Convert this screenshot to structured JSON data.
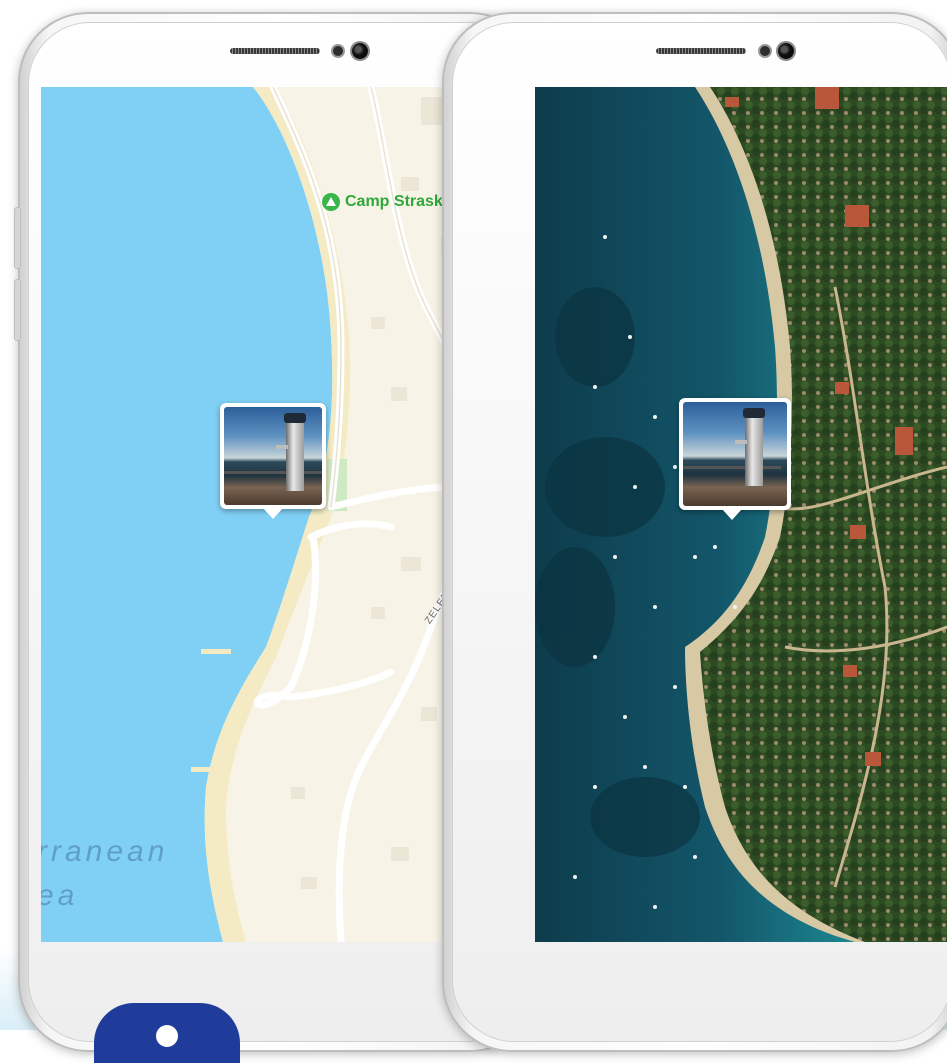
{
  "left_phone": {
    "map_mode": "standard",
    "poi": {
      "label": "Camp Strasko",
      "icon": "campground-icon",
      "color": "#3ab54a"
    },
    "street_label": "ZELENI PUT",
    "sea_label_line1": "rranean",
    "sea_label_line2": "ea",
    "photo_pin": {
      "icon": "photo-thumbnail"
    }
  },
  "right_phone": {
    "map_mode": "satellite",
    "photo_pin": {
      "icon": "photo-thumbnail"
    }
  },
  "colors": {
    "water": "#80d0f5",
    "land": "#f7f3e6",
    "beach": "#f4ebc4",
    "road": "#ffffff",
    "sea_label": "#5f9fc6",
    "badge": "#1f3c9a"
  }
}
